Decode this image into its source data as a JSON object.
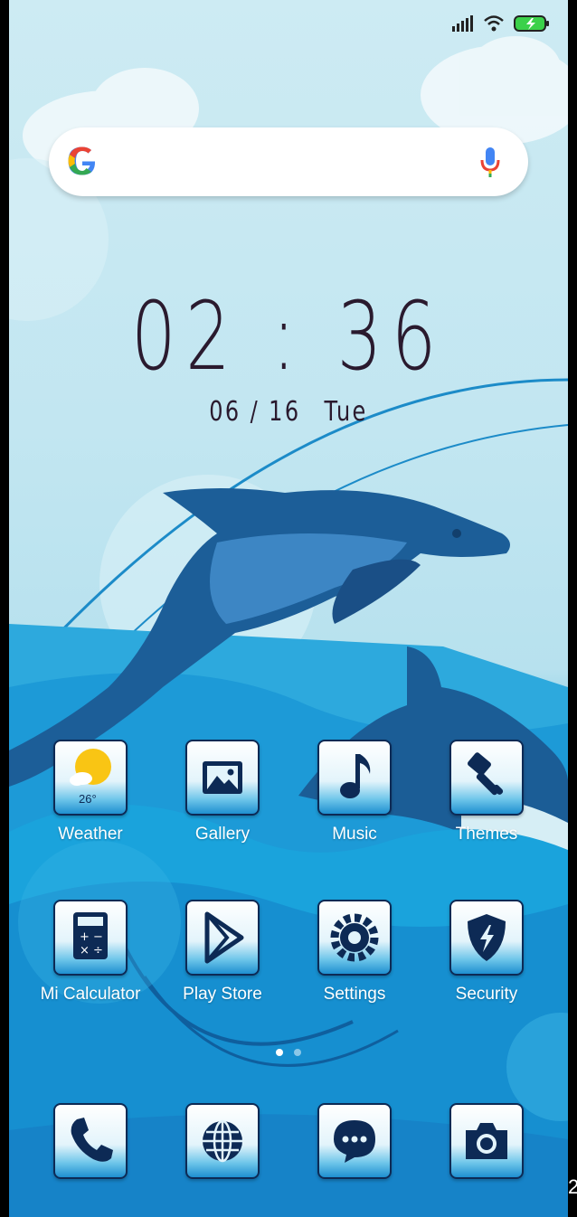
{
  "status_bar": {
    "icons": [
      "signal-icon",
      "wifi-icon",
      "battery-charging-icon"
    ]
  },
  "search_widget": {
    "logo": "google-logo",
    "voice": "mic-icon"
  },
  "clock": {
    "time": "02 : 36",
    "date": "06 / 16",
    "weekday": "Tue"
  },
  "apps": [
    {
      "label": "Weather",
      "icon": "weather-icon",
      "temp": "26°"
    },
    {
      "label": "Gallery",
      "icon": "gallery-icon"
    },
    {
      "label": "Music",
      "icon": "music-note-icon"
    },
    {
      "label": "Themes",
      "icon": "paintbrush-icon"
    },
    {
      "label": "Mi Calculator",
      "icon": "calculator-icon"
    },
    {
      "label": "Play Store",
      "icon": "play-store-icon"
    },
    {
      "label": "Settings",
      "icon": "gear-icon"
    },
    {
      "label": "Security",
      "icon": "shield-icon"
    }
  ],
  "dock": [
    {
      "icon": "phone-icon"
    },
    {
      "icon": "browser-globe-icon"
    },
    {
      "icon": "messaging-icon"
    },
    {
      "icon": "camera-icon"
    }
  ],
  "page_indicator": {
    "pages": 2,
    "active": 0
  },
  "colors": {
    "sky": "#c2e6f1",
    "sea": "#127fc6",
    "dolphin": "#1f5f9a",
    "icon_ink": "#0d2a55"
  },
  "edge_text": "2"
}
